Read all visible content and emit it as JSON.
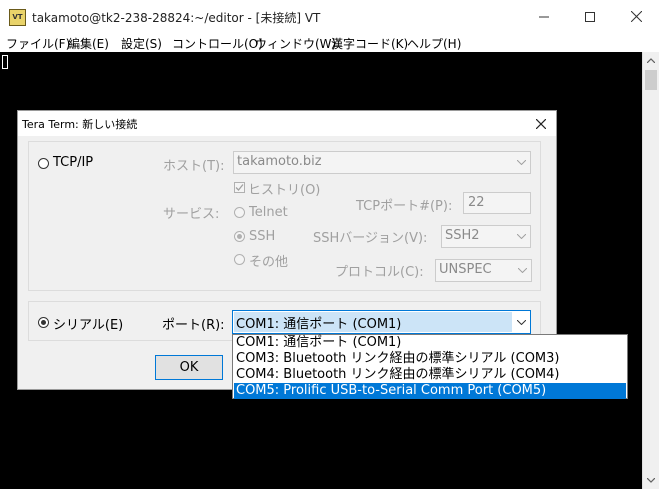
{
  "window": {
    "icon_text": "VT",
    "title": "takamoto@tk2-238-28824:~/editor - [未接続] VT"
  },
  "menu": [
    "ファイル(F)",
    "編集(E)",
    "設定(S)",
    "コントロール(O)",
    "ウィンドウ(W)",
    "漢字コード(K)",
    "ヘルプ(H)"
  ],
  "dialog": {
    "title": "Tera Term: 新しい接続",
    "tcpip": {
      "label": "TCP/IP",
      "host_label": "ホスト(T):",
      "host_value": "takamoto.biz",
      "history_label": "ヒストリ(O)",
      "service_label": "サービス:",
      "telnet_label": "Telnet",
      "ssh_label": "SSH",
      "other_label": "その他",
      "tcpport_label": "TCPポート#(P):",
      "tcpport_value": "22",
      "sshver_label": "SSHバージョン(V):",
      "sshver_value": "SSH2",
      "protocol_label": "プロトコル(C):",
      "protocol_value": "UNSPEC"
    },
    "serial": {
      "label": "シリアル(E)",
      "port_label": "ポート(R):",
      "port_value": "COM1: 通信ポート (COM1)",
      "options": [
        "COM1: 通信ポート (COM1)",
        "COM3: Bluetooth リンク経由の標準シリアル (COM3)",
        "COM4: Bluetooth リンク経由の標準シリアル (COM4)",
        "COM5: Prolific USB-to-Serial Comm Port (COM5)"
      ],
      "highlighted_option": "COM5: Prolific USB-to-Serial Comm Port (COM5)"
    },
    "ok_label": "OK"
  },
  "colors": {
    "accent": "#0078d7",
    "terminal_bg": "#000000",
    "dialog_bg": "#f0f0f0",
    "disabled_text": "#a0a0a0"
  }
}
